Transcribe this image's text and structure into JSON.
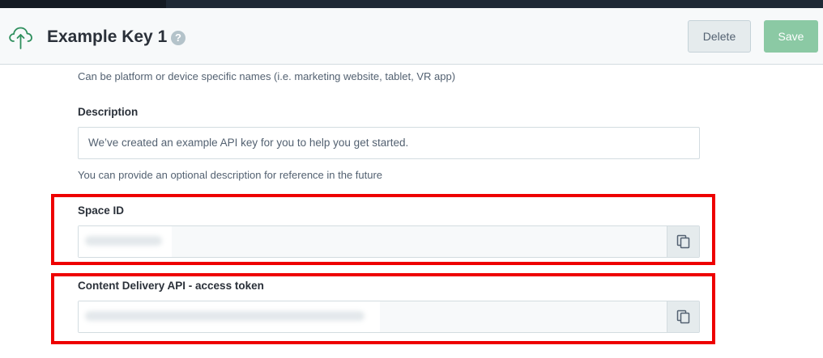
{
  "header": {
    "title": "Example Key 1",
    "help_glyph": "?",
    "delete_label": "Delete",
    "save_label": "Save",
    "icon": "cloud-upload-icon"
  },
  "form": {
    "name_help": "Can be platform or device specific names (i.e. marketing website, tablet, VR app)",
    "description_label": "Description",
    "description_value": "We’ve created an example API key for you to help you get started.",
    "description_help": "You can provide an optional description for reference in the future",
    "space_id_label": "Space ID",
    "space_id_value": "",
    "cda_token_label": "Content Delivery API - access token",
    "cda_token_value": ""
  },
  "colors": {
    "accent": "#2e8f5d",
    "highlight": "#ee0000",
    "save_bg": "#8bc9a4"
  }
}
